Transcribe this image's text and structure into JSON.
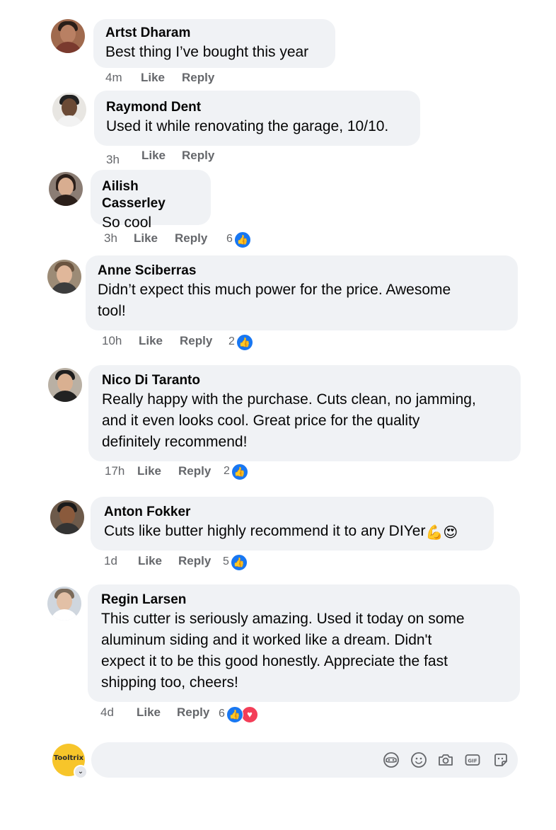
{
  "comments": [
    {
      "name": "Artst Dharam",
      "text": [
        "Best thing I’ve bought this year"
      ],
      "time": "4m",
      "like": "Like",
      "reply": "Reply",
      "reactions": null
    },
    {
      "name": "Raymond Dent",
      "text": [
        "Used it while renovating the garage, 10/10."
      ],
      "time": "3h",
      "like": "Like",
      "reply": "Reply",
      "reactions": null
    },
    {
      "name": "Ailish Casserley",
      "text": [
        "So cool"
      ],
      "time": "3h",
      "like": "Like",
      "reply": "Reply",
      "reactions": {
        "count": "6",
        "types": [
          "like"
        ]
      }
    },
    {
      "name": "Anne Sciberras",
      "text": [
        "Didn’t expect this much power for the price. Awesome",
        "tool!"
      ],
      "time": "10h",
      "like": "Like",
      "reply": "Reply",
      "reactions": {
        "count": "2",
        "types": [
          "like"
        ]
      }
    },
    {
      "name": "Nico Di Taranto",
      "text": [
        "Really happy with the purchase. Cuts clean, no jamming,",
        "and it even looks cool. Great price for the quality",
        "definitely recommend!"
      ],
      "time": "17h",
      "like": "Like",
      "reply": "Reply",
      "reactions": {
        "count": "2",
        "types": [
          "like"
        ]
      }
    },
    {
      "name": "Anton Fokker",
      "text": [
        "Cuts like butter highly recommend it to any DIYer"
      ],
      "emojis": [
        "💪",
        "😍"
      ],
      "time": "1d",
      "like": "Like",
      "reply": "Reply",
      "reactions": {
        "count": "5",
        "types": [
          "like"
        ]
      }
    },
    {
      "name": "Regin Larsen",
      "text": [
        "This cutter is seriously amazing. Used it today on some",
        "aluminum siding and it worked like a dream. Didn't",
        "expect it to be this good honestly. Appreciate the fast",
        "shipping too, cheers!"
      ],
      "time": "4d",
      "like": "Like",
      "reply": "Reply",
      "reactions": {
        "count": "6",
        "types": [
          "like",
          "love"
        ]
      }
    }
  ],
  "composer": {
    "page_logo": "Tooltrix",
    "placeholder": "",
    "tools": [
      "avatar-sticker-icon",
      "emoji-icon",
      "camera-icon",
      "gif-icon",
      "sticker-icon"
    ]
  },
  "colors": {
    "bubble": "#f0f2f5",
    "meta": "#65676b",
    "like": "#1877f2",
    "love": "#f33e58",
    "page_avatar": "#f7c52a"
  }
}
